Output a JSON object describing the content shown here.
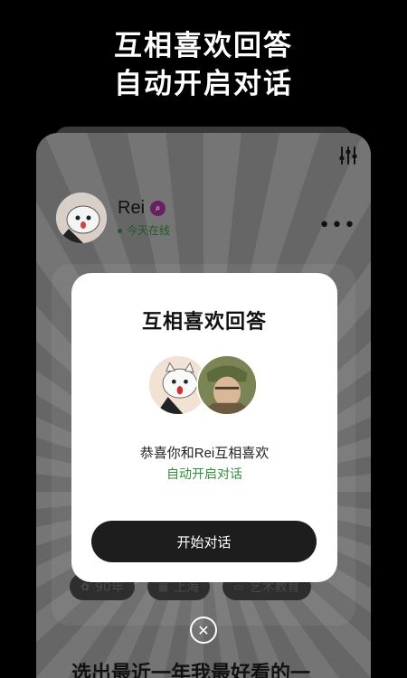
{
  "headline": {
    "line1": "互相喜欢回答",
    "line2": "自动开启对话"
  },
  "profile": {
    "name": "Rei",
    "status": "今天在线"
  },
  "tags": [
    {
      "icon": "flower-icon",
      "label": "90年"
    },
    {
      "icon": "building-icon",
      "label": "上海"
    },
    {
      "icon": "briefcase-icon",
      "label": "艺术教育"
    }
  ],
  "card_question": "选出最近一年我最好看的一",
  "modal": {
    "title": "互相喜欢回答",
    "message": "恭喜你和Rei互相喜欢",
    "sub_message": "自动开启对话",
    "button_label": "开始对话"
  },
  "colors": {
    "accent_green": "#2f8f3c",
    "badge_purple": "#6a1f63",
    "button_dark": "#1d1d1d"
  }
}
